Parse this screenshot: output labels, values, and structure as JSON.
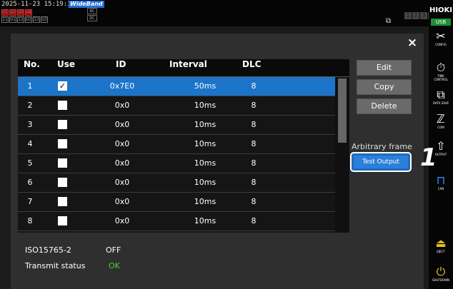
{
  "status_bar": {
    "timestamp": "2025-11-23 15:19:11",
    "mode_badge": "WideBand",
    "channels_top": [
      "U1",
      "U2",
      "U3",
      "U4"
    ],
    "channels_bottom": [
      "I1",
      "U1",
      "I2",
      "U2",
      "I3",
      "U3"
    ],
    "ac_labels": [
      "AC",
      "DC"
    ],
    "pages": [
      "1",
      "2",
      "3",
      "4"
    ]
  },
  "side_panel": {
    "logo": "HIOKI",
    "usb": "USB",
    "buttons": [
      {
        "icon": "config-icon",
        "glyph": "✂",
        "label": "CONFIG"
      },
      {
        "icon": "time-control-icon",
        "glyph": "⏱",
        "label": "TIME CONTROL"
      },
      {
        "icon": "data-save-icon",
        "glyph": "⧉",
        "label": "DATA SAVE"
      },
      {
        "icon": "com-icon",
        "glyph": "ℤ",
        "label": "COM"
      },
      {
        "icon": "output-icon",
        "glyph": "⇧",
        "label": "OUTPUT"
      },
      {
        "icon": "can-icon",
        "glyph": "⊓",
        "label": "CAN"
      },
      {
        "icon": "eject-icon",
        "glyph": "⏏",
        "label": "EJECT"
      },
      {
        "icon": "shutdown-icon",
        "glyph": "⏻",
        "label": "SHUTDOWN"
      }
    ]
  },
  "dialog": {
    "close": "×",
    "columns": [
      "No.",
      "Use",
      "ID",
      "Interval",
      "DLC"
    ],
    "rows": [
      {
        "no": "1",
        "use": true,
        "id": "0x7E0",
        "interval": "50ms",
        "dlc": "8"
      },
      {
        "no": "2",
        "use": false,
        "id": "0x0",
        "interval": "10ms",
        "dlc": "8"
      },
      {
        "no": "3",
        "use": false,
        "id": "0x0",
        "interval": "10ms",
        "dlc": "8"
      },
      {
        "no": "4",
        "use": false,
        "id": "0x0",
        "interval": "10ms",
        "dlc": "8"
      },
      {
        "no": "5",
        "use": false,
        "id": "0x0",
        "interval": "10ms",
        "dlc": "8"
      },
      {
        "no": "6",
        "use": false,
        "id": "0x0",
        "interval": "10ms",
        "dlc": "8"
      },
      {
        "no": "7",
        "use": false,
        "id": "0x0",
        "interval": "10ms",
        "dlc": "8"
      },
      {
        "no": "8",
        "use": false,
        "id": "0x0",
        "interval": "10ms",
        "dlc": "8"
      }
    ],
    "selected_row": 0,
    "buttons": {
      "edit": "Edit",
      "copy": "Copy",
      "delete": "Delete"
    },
    "arbitrary_frame_label": "Arbitrary frame",
    "test_output": "Test Output",
    "step_marker": "1",
    "iso_label": "ISO15765-2",
    "iso_value": "OFF",
    "transmit_label": "Transmit status",
    "transmit_value": "OK"
  },
  "colors": {
    "selection": "#1b74c8",
    "ok": "#4bd12f",
    "test_button": "#2b7fd9"
  }
}
